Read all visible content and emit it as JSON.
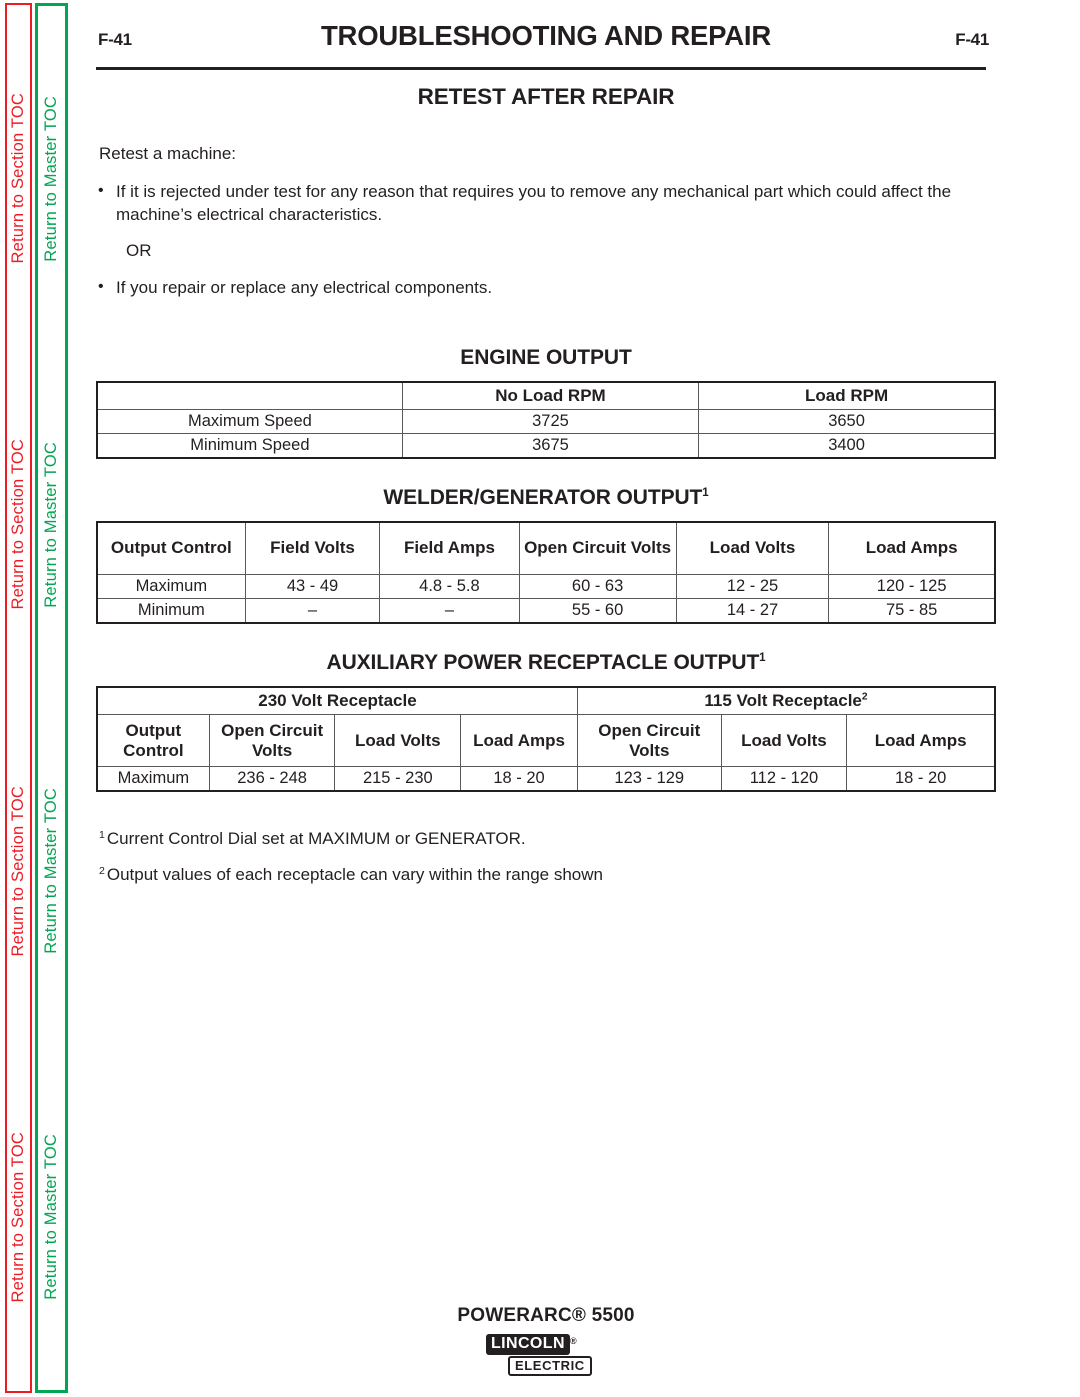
{
  "sidebar": {
    "section_toc": {
      "label": "Return to Section TOC",
      "color": "#ed1c24",
      "repeats": 4
    },
    "master_toc": {
      "label": "Return to Master TOC",
      "color": "#00a651",
      "repeats": 4
    }
  },
  "header": {
    "folio_left": "F-41",
    "folio_right": "F-41",
    "title": "TROUBLESHOOTING AND REPAIR",
    "section_title": "RETEST AFTER REPAIR"
  },
  "body": {
    "intro": "Retest a machine:",
    "bullets": [
      "If it is rejected under test for any reason that requires you to remove any mechanical part which could affect the machine’s electrical characteristics.",
      "If you repair or replace any electrical components."
    ],
    "or_text": "OR"
  },
  "tables": {
    "engine": {
      "heading": "ENGINE OUTPUT",
      "heading_sup": "",
      "columns": [
        "",
        "No Load RPM",
        "Load RPM"
      ],
      "rows": [
        [
          "Maximum Speed",
          "3725",
          "3650"
        ],
        [
          "Minimum Speed",
          "3675",
          "3400"
        ]
      ]
    },
    "welder": {
      "heading": "WELDER/GENERATOR OUTPUT",
      "heading_sup": "1",
      "columns": [
        "Output Control",
        "Field Volts",
        "Field Amps",
        "Open Circuit Volts",
        "Load Volts",
        "Load Amps"
      ],
      "rows": [
        [
          "Maximum",
          "43 - 49",
          "4.8 - 5.8",
          "60 - 63",
          "12 - 25",
          "120 - 125"
        ],
        [
          "Minimum",
          "–",
          "–",
          "55 - 60",
          "14 - 27",
          "75 - 85"
        ]
      ]
    },
    "aux": {
      "heading": "AUXILIARY POWER RECEPTACLE OUTPUT",
      "heading_sup": "1",
      "group_230": "230 Volt Receptacle",
      "group_115": "115 Volt Receptacle",
      "group_115_sup": "2",
      "columns": [
        "Output Control",
        "Open Circuit Volts",
        "Load Volts",
        "Load Amps",
        "Open Circuit Volts",
        "Load Volts",
        "Load Amps"
      ],
      "rows": [
        [
          "Maximum",
          "236 - 248",
          "215 - 230",
          "18 - 20",
          "123 - 129",
          "112 - 120",
          "18 - 20"
        ]
      ]
    }
  },
  "footnotes": [
    {
      "marker": "1",
      "text": "Current Control Dial set at MAXIMUM or GENERATOR."
    },
    {
      "marker": "2",
      "text": "Output values of each receptacle can vary within the range shown"
    }
  ],
  "footer": {
    "model": "POWERARC® 5500",
    "logo_primary": "LINCOLN",
    "logo_reg": "®",
    "logo_secondary": "ELECTRIC"
  }
}
